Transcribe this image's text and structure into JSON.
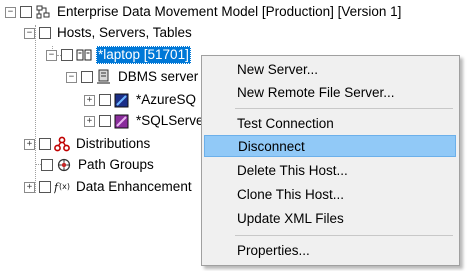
{
  "tree": {
    "root": {
      "label": "Enterprise Data Movement Model [Production] [Version 1]",
      "icon": "model-icon"
    },
    "hosts": {
      "label": "Hosts, Servers, Tables",
      "icon": "none"
    },
    "laptop": {
      "label": "*laptop [51701]",
      "icon": "host-icon"
    },
    "dbms": {
      "label": "DBMS server",
      "icon": "server-icon"
    },
    "azure": {
      "label": "*AzureSQ",
      "icon": "azure-db-icon"
    },
    "sqlserver": {
      "label": "*SQLServe",
      "icon": "sqlserver-db-icon"
    },
    "distributions": {
      "label": "Distributions",
      "icon": "distribution-icon"
    },
    "path_groups": {
      "label": "Path Groups",
      "icon": "path-group-icon"
    },
    "data_enh": {
      "label": "Data Enhancement",
      "icon": "function-icon"
    }
  },
  "context_menu": {
    "items": [
      "New Server...",
      "New Remote File Server...",
      "Test Connection",
      "Disconnect",
      "Delete This Host...",
      "Clone This Host...",
      "Update XML Files",
      "Properties..."
    ],
    "highlighted": "Disconnect"
  },
  "colors": {
    "selection": "#0078d7",
    "menu_background": "#f0f0f0",
    "menu_highlight": "#91c9f7"
  }
}
